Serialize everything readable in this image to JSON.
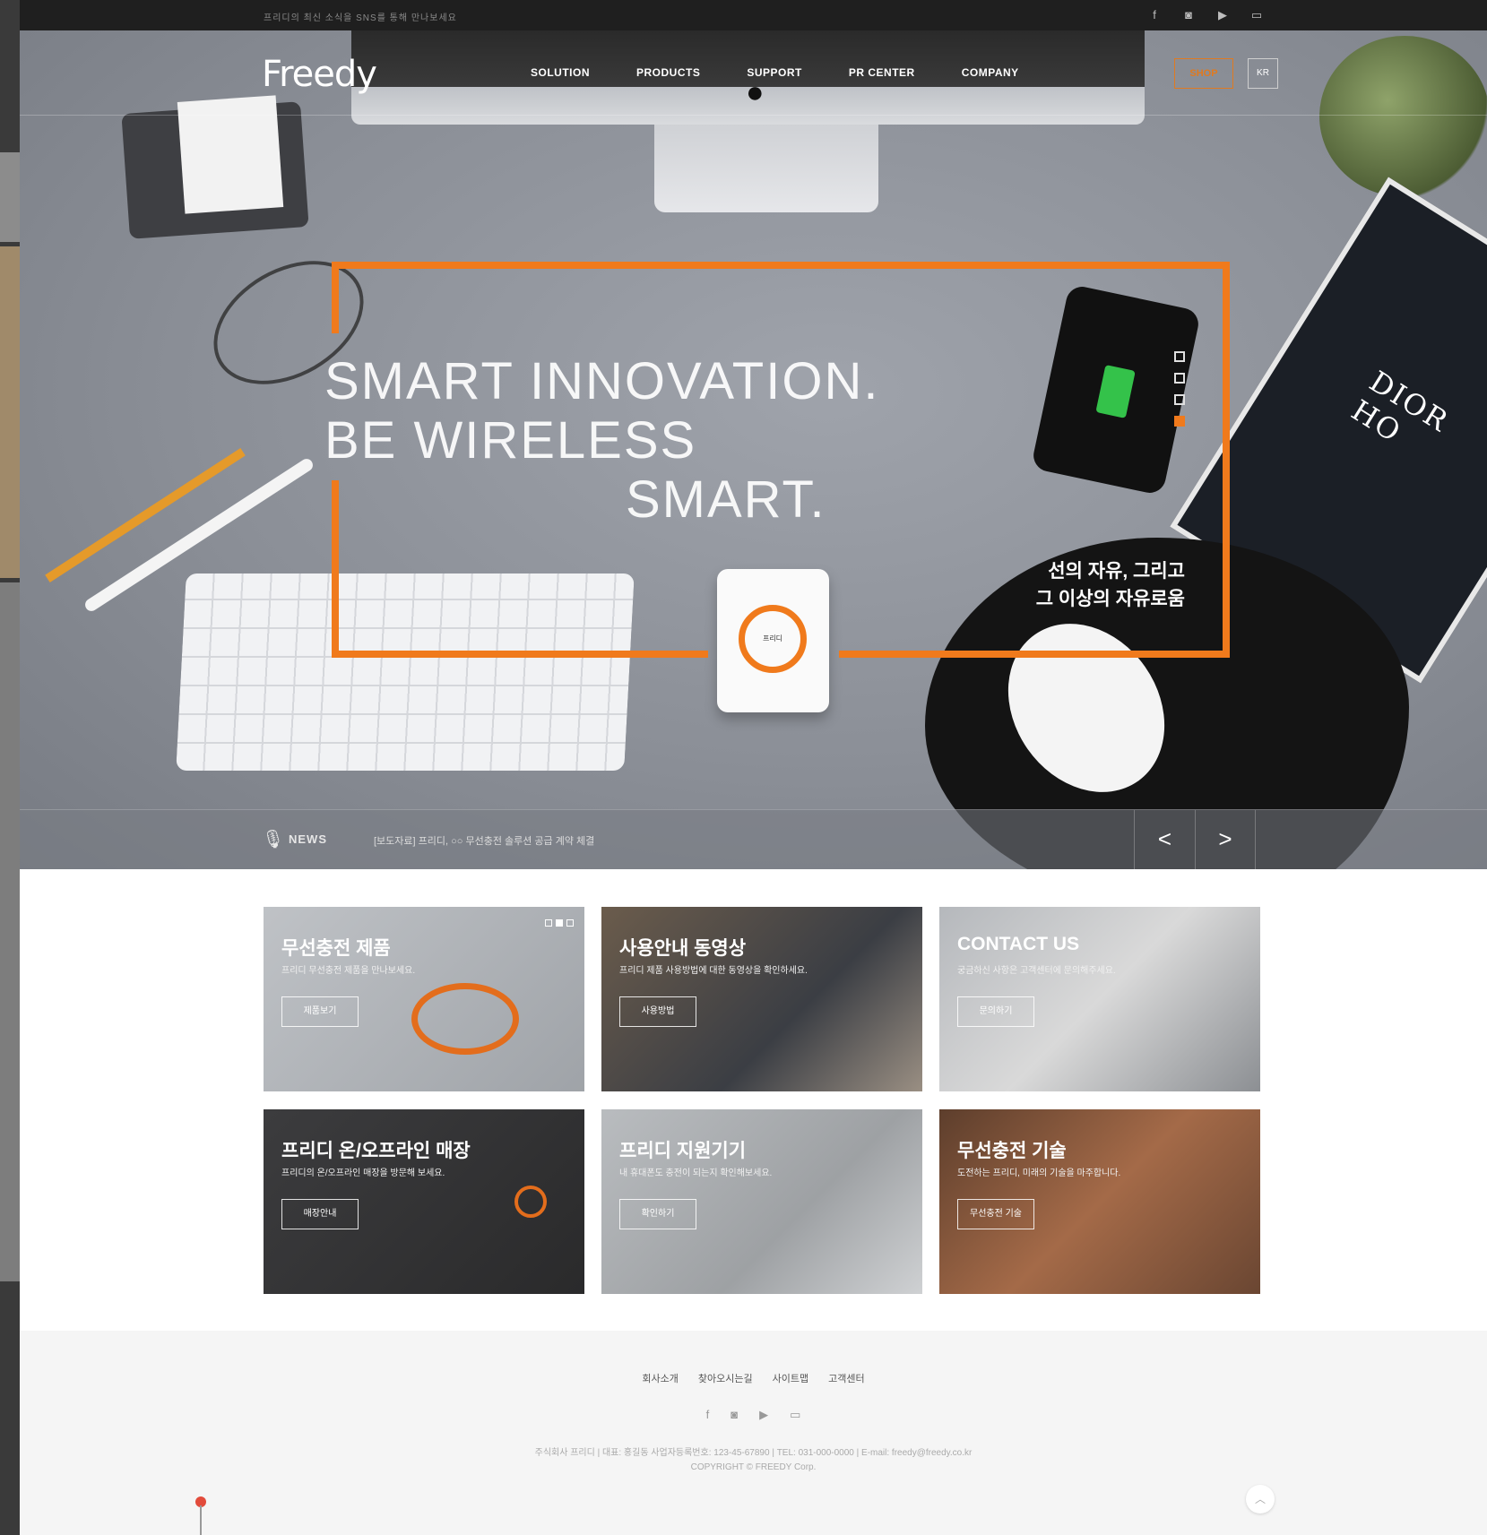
{
  "topbar": {
    "text": "프리디의 최신 소식을 SNS를 통해 만나보세요",
    "social": [
      {
        "icon": "facebook-icon",
        "glyph": "f"
      },
      {
        "icon": "instagram-icon",
        "glyph": "◙"
      },
      {
        "icon": "youtube-icon",
        "glyph": "▶"
      },
      {
        "icon": "blog-icon",
        "glyph": "▭"
      }
    ]
  },
  "header": {
    "logo": "Freedy",
    "nav": [
      "SOLUTION",
      "PRODUCTS",
      "SUPPORT",
      "PR CENTER",
      "COMPANY"
    ],
    "shop_label": "SHOP",
    "lang_label": "KR"
  },
  "hero": {
    "line1": "SMART INNOVATION.",
    "line2": "BE WIRELESS",
    "line3": "SMART.",
    "kor_line1": "선의 자유, 그리고",
    "kor_line2": "그 이상의 자유로움",
    "charger_label": "프리디",
    "book_title": "DIOR HO",
    "slide_count": 4,
    "active_slide": 4
  },
  "news": {
    "label": "NEWS",
    "text": "[보도자료] 프리디, ○○ 무선충전 솔루션 공급 계약 체결",
    "prev": "<",
    "next": ">"
  },
  "tiles": [
    {
      "title": "무선충전 제품",
      "desc": "프리디 무선충전 제품을 만나보세요.",
      "button": "제품보기"
    },
    {
      "title": "사용안내 동영상",
      "desc": "프리디 제품 사용방법에 대한 동영상을 확인하세요.",
      "button": "사용방법"
    },
    {
      "title": "CONTACT US",
      "desc": "궁금하신 사항은 고객센터에 문의해주세요.",
      "button": "문의하기"
    },
    {
      "title": "프리디 온/오프라인 매장",
      "desc": "프리디의 온/오프라인 매장을 방문해 보세요.",
      "button": "매장안내"
    },
    {
      "title": "프리디 지원기기",
      "desc": "내 휴대폰도 충전이 되는지 확인해보세요.",
      "button": "확인하기"
    },
    {
      "title": "무선충전 기술",
      "desc": "도전하는 프리디, 미래의 기술을 마주합니다.",
      "button": "무선충전 기술"
    }
  ],
  "footer": {
    "links": [
      "회사소개",
      "찾아오시는길",
      "사이트맵",
      "고객센터"
    ],
    "social": [
      {
        "icon": "facebook-icon",
        "glyph": "f"
      },
      {
        "icon": "instagram-icon",
        "glyph": "◙"
      },
      {
        "icon": "youtube-icon",
        "glyph": "▶"
      },
      {
        "icon": "blog-icon",
        "glyph": "▭"
      }
    ],
    "info_line1": "주식회사 프리디 | 대표: 홍길동   사업자등록번호: 123-45-67890  |  TEL: 031-000-0000  |  E-mail: freedy@freedy.co.kr",
    "info_line2": "COPYRIGHT © FREEDY Corp.",
    "to_top": "︿"
  },
  "colors": {
    "accent": "#f07a1c",
    "topbar": "#1f1f1f",
    "footer_bg": "#f5f5f5"
  }
}
